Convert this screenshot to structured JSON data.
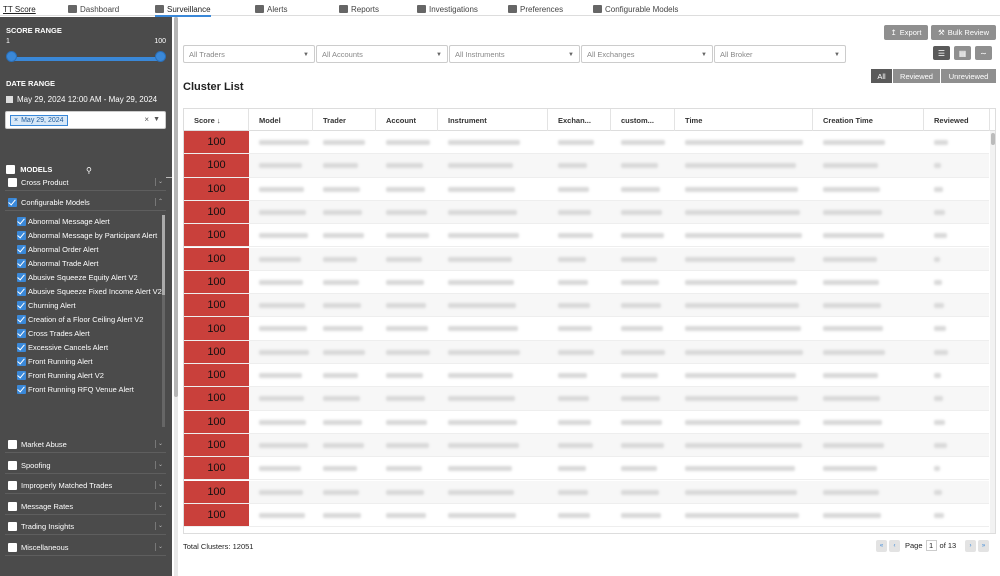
{
  "nav": {
    "brand": "TT Score",
    "items": [
      {
        "label": "Dashboard",
        "icon": "dashboard-icon"
      },
      {
        "label": "Surveillance",
        "icon": "surveillance-icon",
        "active": true
      },
      {
        "label": "Alerts",
        "icon": "bell-icon"
      },
      {
        "label": "Reports",
        "icon": "folder-icon"
      },
      {
        "label": "Investigations",
        "icon": "document-icon"
      },
      {
        "label": "Preferences",
        "icon": "users-icon"
      },
      {
        "label": "Configurable Models",
        "icon": "sliders-icon"
      }
    ]
  },
  "sidebar": {
    "score_range": {
      "title": "SCORE RANGE",
      "min": "1",
      "max": "100",
      "low": 1,
      "high": 100
    },
    "date_range": {
      "title": "DATE RANGE",
      "display": "May 29, 2024 12:00 AM - May 29, 2024",
      "chip": "May 29, 2024"
    },
    "models": {
      "title": "MODELS",
      "groups_top": [
        {
          "label": "Cross Product",
          "checked": false
        },
        {
          "label": "Configurable Models",
          "checked": true
        }
      ],
      "configurable_items": [
        "Abnormal Message Alert",
        "Abnormal Message by Participant Alert",
        "Abnormal Order Alert",
        "Abnormal Trade Alert",
        "Abusive Squeeze Equity Alert V2",
        "Abusive Squeeze Fixed Income Alert V2",
        "Churning Alert",
        "Creation of a Floor Ceiling Alert V2",
        "Cross Trades Alert",
        "Excessive Cancels Alert",
        "Front Running Alert",
        "Front Running Alert V2",
        "Front Running RFQ Venue Alert"
      ],
      "groups_bottom": [
        {
          "label": "Market Abuse",
          "checked": false
        },
        {
          "label": "Spoofing",
          "checked": false
        },
        {
          "label": "Improperly Matched Trades",
          "checked": false
        },
        {
          "label": "Message Rates",
          "checked": false
        },
        {
          "label": "Trading Insights",
          "checked": false
        },
        {
          "label": "Miscellaneous",
          "checked": false
        }
      ]
    }
  },
  "toolbar": {
    "export_label": "Export",
    "bulk_review_label": "Bulk Review"
  },
  "filters": [
    {
      "placeholder": "All Traders"
    },
    {
      "placeholder": "All Accounts"
    },
    {
      "placeholder": "All Instruments"
    },
    {
      "placeholder": "All Exchanges"
    },
    {
      "placeholder": "All Broker"
    }
  ],
  "segment": {
    "items": [
      "All",
      "Reviewed",
      "Unreviewed"
    ],
    "active": "All"
  },
  "cluster": {
    "title": "Cluster List",
    "columns": [
      "Score ↓",
      "Model",
      "Trader",
      "Account",
      "Instrument",
      "Exchan...",
      "custom...",
      "Time",
      "Creation Time",
      "Reviewed"
    ],
    "scores": [
      "100",
      "100",
      "100",
      "100",
      "100",
      "100",
      "100",
      "100",
      "100",
      "100",
      "100",
      "100",
      "100",
      "100",
      "100",
      "100",
      "100"
    ]
  },
  "footer": {
    "total_label": "Total Clusters: 12051",
    "page_label": "Page",
    "page_value": "1",
    "of_label": "of 13"
  },
  "colors": {
    "accent": "#3a88d8",
    "score_high": "#c9403b",
    "sidebar_bg": "#4b4b4b"
  }
}
